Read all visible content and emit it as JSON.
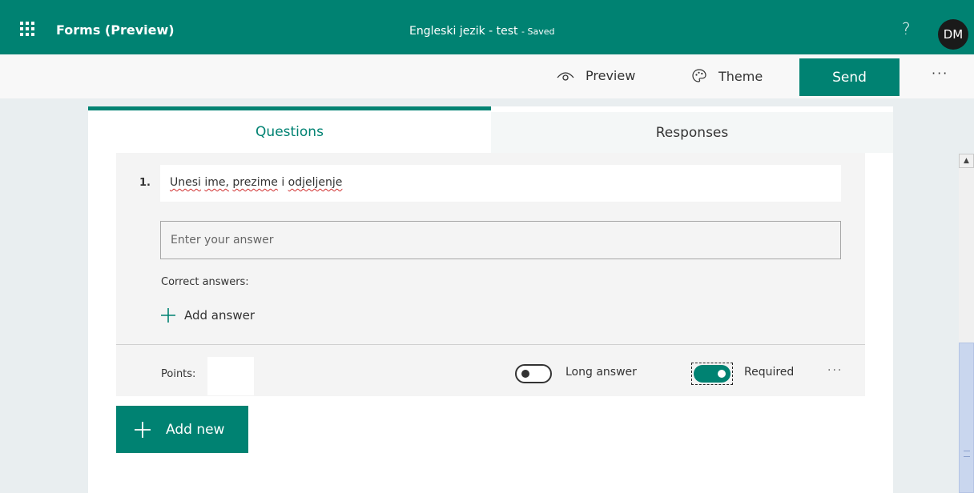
{
  "header": {
    "app_name": "Forms (Preview)",
    "doc_title": "Engleski jezik - test",
    "doc_status": "- Saved",
    "help": "?",
    "avatar": "DM"
  },
  "commands": {
    "preview": "Preview",
    "theme": "Theme",
    "send": "Send",
    "more": "···"
  },
  "tabs": {
    "questions": "Questions",
    "responses": "Responses",
    "active": "Questions"
  },
  "question": {
    "number": "1.",
    "title_words": [
      "Unesi",
      "ime,",
      "prezime",
      "i",
      "odjeljenje"
    ],
    "answer_placeholder": "Enter your answer",
    "correct_answers_label": "Correct answers:",
    "add_answer": "Add answer",
    "points_label": "Points:",
    "points_value": "",
    "long_answer_label": "Long answer",
    "long_answer_on": false,
    "required_label": "Required",
    "required_on": true,
    "more": "···"
  },
  "add_new": "Add new",
  "colors": {
    "brand": "#008272",
    "spellcheck": "#d03030"
  },
  "icons": [
    "app-launcher-icon",
    "eye-icon",
    "palette-icon",
    "plus-icon",
    "scroll-up-icon"
  ]
}
